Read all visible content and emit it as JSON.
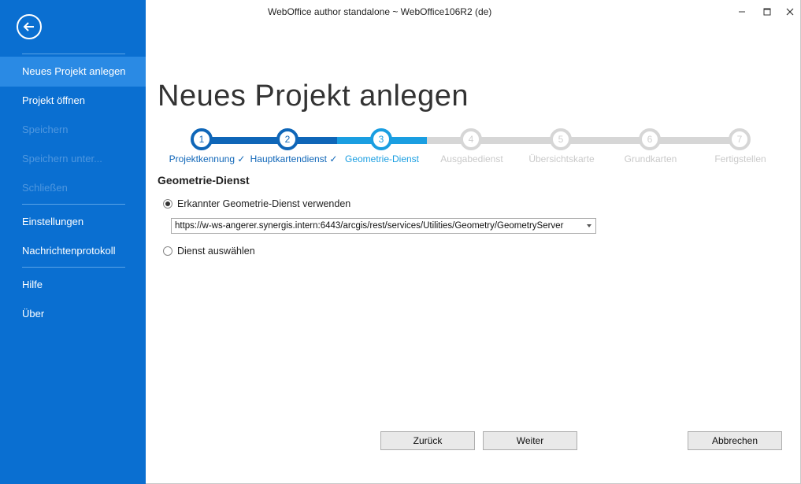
{
  "window": {
    "title": "WebOffice author standalone ~ WebOffice106R2 (de)"
  },
  "sidebar": {
    "items": [
      {
        "label": "Neues Projekt anlegen",
        "state": "active"
      },
      {
        "label": "Projekt öffnen",
        "state": "normal"
      },
      {
        "label": "Speichern",
        "state": "disabled"
      },
      {
        "label": "Speichern unter...",
        "state": "disabled"
      },
      {
        "label": "Schließen",
        "state": "disabled"
      },
      {
        "label": "Einstellungen",
        "state": "normal"
      },
      {
        "label": "Nachrichtenprotokoll",
        "state": "normal"
      },
      {
        "label": "Hilfe",
        "state": "normal"
      },
      {
        "label": "Über",
        "state": "normal"
      }
    ]
  },
  "page": {
    "title": "Neues Projekt anlegen"
  },
  "wizard": {
    "steps": [
      {
        "number": "1",
        "label": "Projektkennung ✓",
        "state": "done"
      },
      {
        "number": "2",
        "label": "Hauptkartendienst ✓",
        "state": "done"
      },
      {
        "number": "3",
        "label": "Geometrie-Dienst",
        "state": "current"
      },
      {
        "number": "4",
        "label": "Ausgabedienst",
        "state": "todo"
      },
      {
        "number": "5",
        "label": "Übersichtskarte",
        "state": "todo"
      },
      {
        "number": "6",
        "label": "Grundkarten",
        "state": "todo"
      },
      {
        "number": "7",
        "label": "Fertigstellen",
        "state": "todo"
      }
    ]
  },
  "section": {
    "title": "Geometrie-Dienst",
    "option_detected": "Erkannter Geometrie-Dienst verwenden",
    "service_url": "https://w-ws-angerer.synergis.intern:6443/arcgis/rest/services/Utilities/Geometry/GeometryServer",
    "option_choose": "Dienst auswählen"
  },
  "buttons": {
    "back": "Zurück",
    "next": "Weiter",
    "cancel": "Abbrechen"
  },
  "colors": {
    "sidebar": "#0a6fd1",
    "step_done": "#0f66b8",
    "step_current": "#1a9ee1",
    "step_todo": "#d6d6d6"
  }
}
